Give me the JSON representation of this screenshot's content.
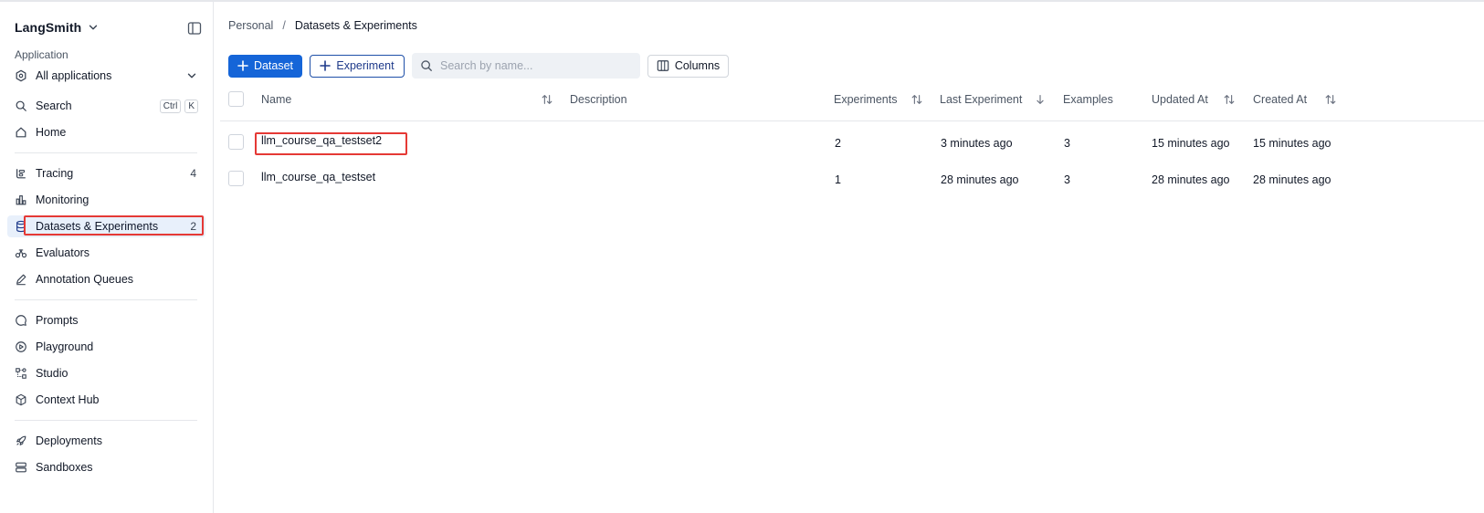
{
  "app": {
    "brand": "LangSmith",
    "application_label": "Application"
  },
  "sidebar": {
    "app_selector": "All applications",
    "search": {
      "label": "Search",
      "kbd": [
        "Ctrl",
        "K"
      ]
    },
    "items": [
      {
        "label": "Home",
        "icon": "home-icon"
      },
      {
        "label": "Tracing",
        "icon": "tracing-icon",
        "count": "4"
      },
      {
        "label": "Monitoring",
        "icon": "monitoring-icon"
      },
      {
        "label": "Datasets & Experiments",
        "icon": "database-icon",
        "count": "2",
        "active": true
      },
      {
        "label": "Evaluators",
        "icon": "evaluators-icon"
      },
      {
        "label": "Annotation Queues",
        "icon": "pencil-icon"
      },
      {
        "label": "Prompts",
        "icon": "prompts-icon"
      },
      {
        "label": "Playground",
        "icon": "playground-icon"
      },
      {
        "label": "Studio",
        "icon": "studio-icon"
      },
      {
        "label": "Context Hub",
        "icon": "cube-icon"
      },
      {
        "label": "Deployments",
        "icon": "rocket-icon"
      },
      {
        "label": "Sandboxes",
        "icon": "server-icon"
      }
    ]
  },
  "breadcrumb": {
    "root": "Personal",
    "separator": "/",
    "current": "Datasets & Experiments"
  },
  "toolbar": {
    "dataset_button": "Dataset",
    "experiment_button": "Experiment",
    "search_placeholder": "Search by name...",
    "columns_button": "Columns"
  },
  "table": {
    "columns": {
      "name": "Name",
      "description": "Description",
      "experiments": "Experiments",
      "last_experiment": "Last Experiment",
      "examples": "Examples",
      "updated_at": "Updated At",
      "created_at": "Created At"
    },
    "rows": [
      {
        "name": "llm_course_qa_testset2",
        "description": "",
        "experiments": "2",
        "last_experiment": "3 minutes ago",
        "examples": "3",
        "updated_at": "15 minutes ago",
        "created_at": "15 minutes ago"
      },
      {
        "name": "llm_course_qa_testset",
        "description": "",
        "experiments": "1",
        "last_experiment": "28 minutes ago",
        "examples": "3",
        "updated_at": "28 minutes ago",
        "created_at": "28 minutes ago"
      }
    ]
  },
  "colors": {
    "primary": "#1565d8",
    "active_bg": "#e8f0fb",
    "highlight": "#e53935"
  }
}
